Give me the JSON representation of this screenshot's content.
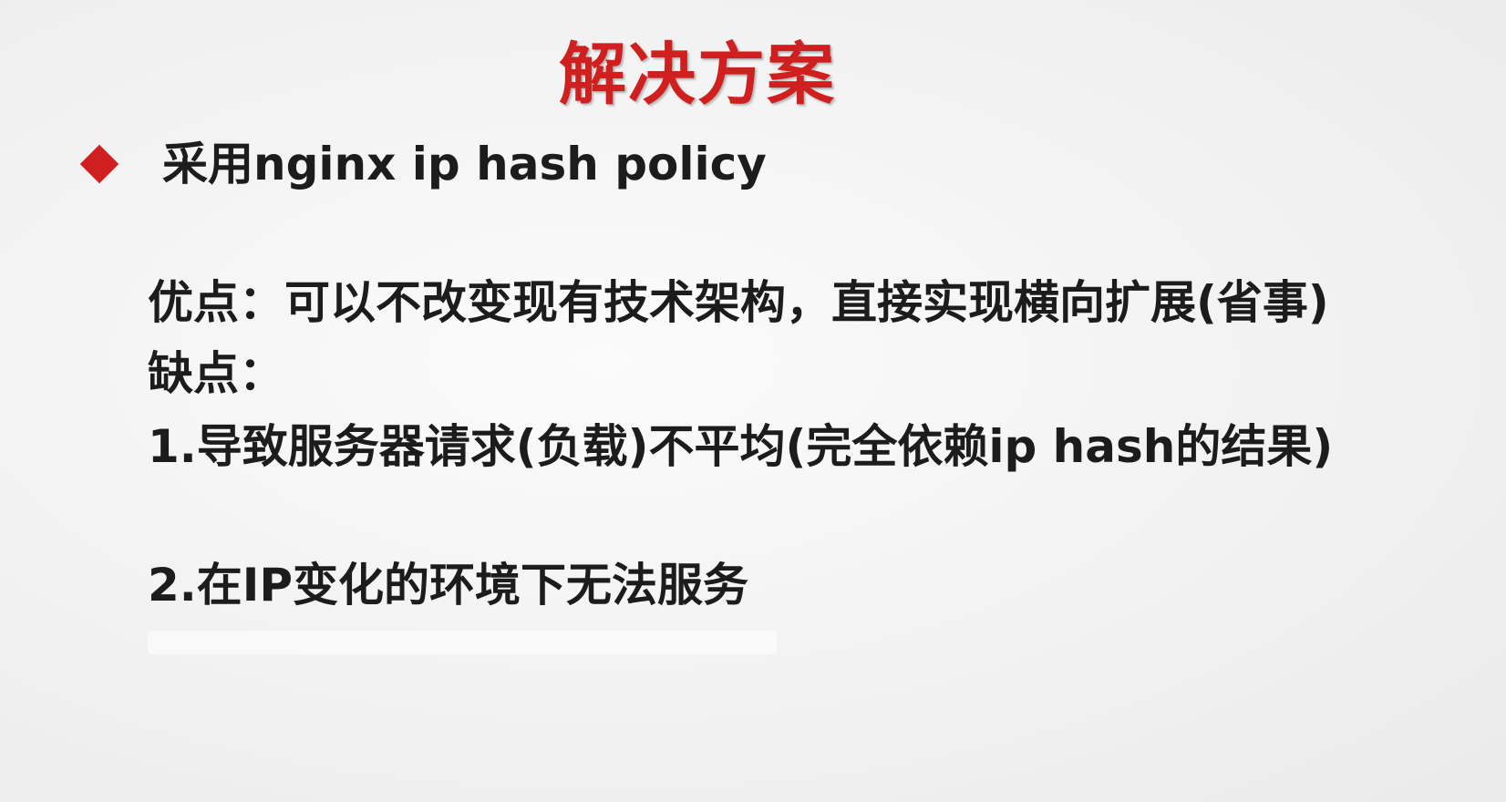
{
  "slide": {
    "title": "解决方案",
    "bullet": "采用nginx ip hash policy",
    "pros": "优点：可以不改变现有技术架构，直接实现横向扩展(省事)",
    "cons_label": "缺点：",
    "con1": "1.导致服务器请求(负载)不平均(完全依赖ip hash的结果)",
    "con2": "2.在IP变化的环境下无法服务"
  },
  "colors": {
    "accent": "#cf1f1f",
    "text": "#1c1c1c",
    "background": "#f3f3f3"
  }
}
